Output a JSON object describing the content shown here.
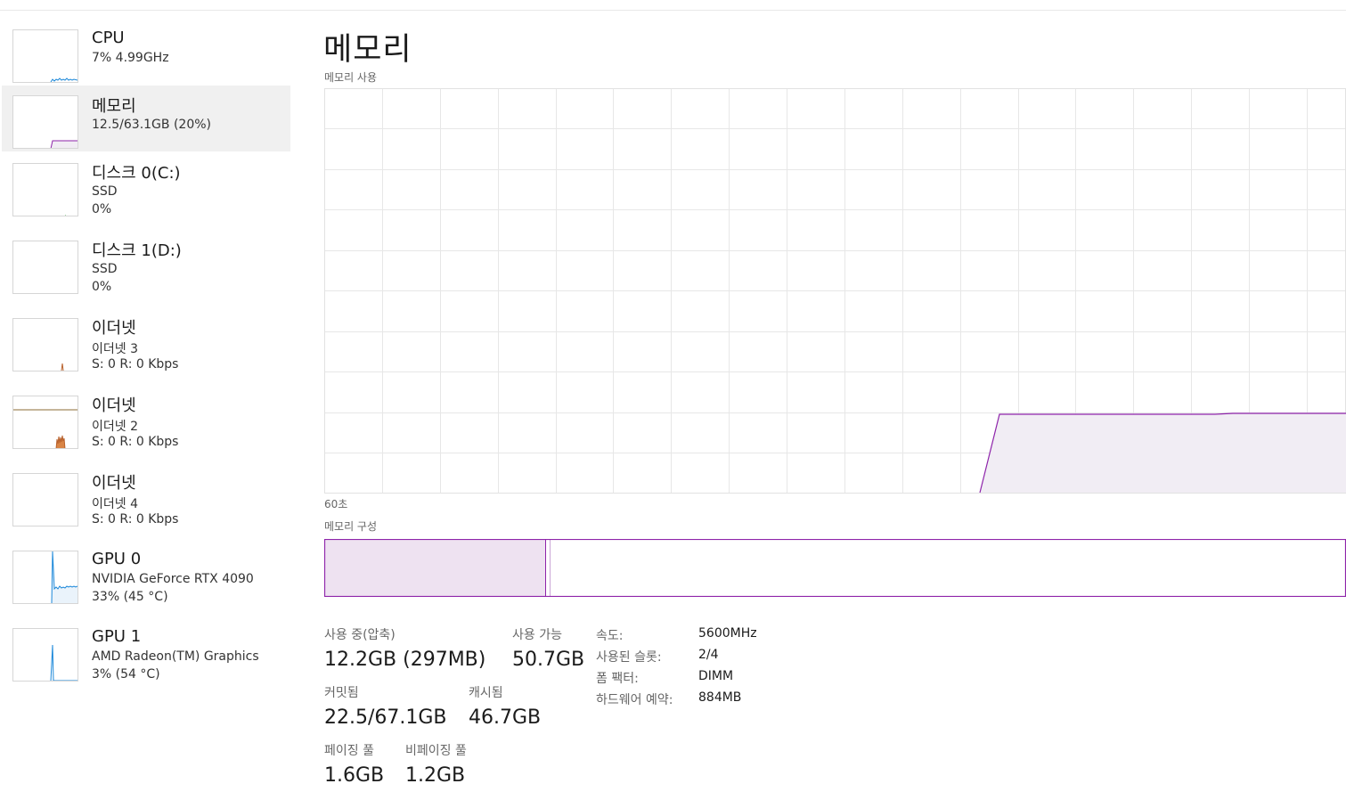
{
  "sidebar": {
    "items": [
      {
        "title": "CPU",
        "line1": "7% 4.99GHz",
        "line2": ""
      },
      {
        "title": "메모리",
        "line1": "12.5/63.1GB (20%)",
        "line2": ""
      },
      {
        "title": "디스크 0(C:)",
        "line1": "SSD",
        "line2": "0%"
      },
      {
        "title": "디스크 1(D:)",
        "line1": "SSD",
        "line2": "0%"
      },
      {
        "title": "이더넷",
        "line1": "이더넷 3",
        "line2": "S: 0 R: 0 Kbps"
      },
      {
        "title": "이더넷",
        "line1": "이더넷 2",
        "line2": "S: 0 R: 0 Kbps"
      },
      {
        "title": "이더넷",
        "line1": "이더넷 4",
        "line2": "S: 0 R: 0 Kbps"
      },
      {
        "title": "GPU 0",
        "line1": "NVIDIA GeForce RTX 4090",
        "line2": "33% (45 °C)"
      },
      {
        "title": "GPU 1",
        "line1": "AMD Radeon(TM) Graphics",
        "line2": "3% (54 °C)"
      }
    ],
    "selected_index": 1
  },
  "main": {
    "title": "메모리",
    "usage_label": "메모리 사용",
    "time_span_label": "60초",
    "composition_label": "메모리 구성",
    "graph_color": "#8e24aa",
    "graph_fill": "#f1edf4",
    "composition_fill": "#eee2f1",
    "in_use_fraction": 0.2
  },
  "stats": {
    "in_use_label": "사용 중(압축)",
    "in_use_value": "12.2GB (297MB)",
    "available_label": "사용 가능",
    "available_value": "50.7GB",
    "committed_label": "커밋됨",
    "committed_value": "22.5/67.1GB",
    "cached_label": "캐시됨",
    "cached_value": "46.7GB",
    "paged_pool_label": "페이징 풀",
    "paged_pool_value": "1.6GB",
    "nonpaged_pool_label": "비페이징 풀",
    "nonpaged_pool_value": "1.2GB"
  },
  "specs": {
    "speed_label": "속도:",
    "speed_value": "5600MHz",
    "slots_label": "사용된 슬롯:",
    "slots_value": "2/4",
    "form_factor_label": "폼 팩터:",
    "form_factor_value": "DIMM",
    "hw_reserved_label": "하드웨어 예약:",
    "hw_reserved_value": "884MB"
  }
}
